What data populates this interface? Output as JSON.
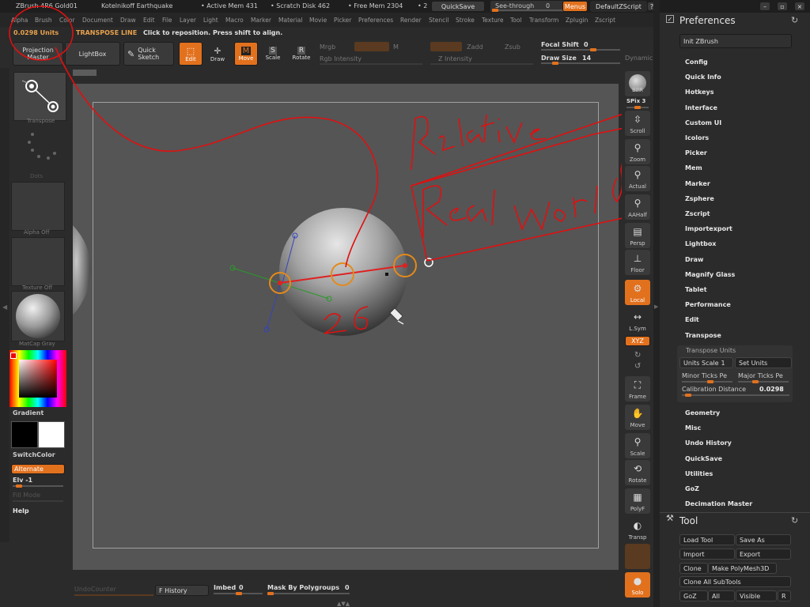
{
  "titlebar": {
    "app": "ZBrush 4R6 Gold01",
    "user": "Kotelnikoff Earthquake",
    "active_mem": "• Active Mem 431",
    "scratch": "• Scratch Disk 462",
    "free_mem": "• Free Mem 2304",
    "dot": "• 2",
    "quicksave": "QuickSave",
    "seethrough": "See-through",
    "seethrough_val": "0",
    "menus": "Menus",
    "defaultzscript": "DefaultZScript"
  },
  "menubar": [
    "Alpha",
    "Brush",
    "Color",
    "Document",
    "Draw",
    "Edit",
    "File",
    "Layer",
    "Light",
    "Macro",
    "Marker",
    "Material",
    "Movie",
    "Picker",
    "Preferences",
    "Render",
    "Stencil",
    "Stroke",
    "Texture",
    "Tool",
    "Transform",
    "Zplugin",
    "Zscript"
  ],
  "infobar": {
    "units": "0.0298 Units",
    "transpose": "TRANSPOSE LINE",
    "hint": "Click to reposition. Press shift to align."
  },
  "toolbar": {
    "projection_master": "Projection Master",
    "lightbox": "LightBox",
    "quick_sketch": "Quick Sketch",
    "edit": "Edit",
    "draw": "Draw",
    "move": "Move",
    "scale": "Scale",
    "rotate": "Rotate",
    "mrgb": "Mrgb",
    "rgb_intensity": "Rgb Intensity",
    "m": "M",
    "zadd": "Zadd",
    "zsub": "Zsub",
    "z_intensity": "Z Intensity",
    "focal_shift": "Focal Shift",
    "focal_val": "0",
    "draw_size": "Draw Size",
    "draw_size_val": "14",
    "dynamic": "Dynamic"
  },
  "leftpanel": {
    "transpose": "Transpose",
    "dots": "Dots",
    "alpha_off": "Alpha Off",
    "texture_off": "Texture Off",
    "matcap": "MatCap Gray",
    "gradient": "Gradient",
    "switchcolor": "SwitchColor",
    "alternate": "Alternate",
    "elv": "Elv -1",
    "fill_mode": "Fill Mode",
    "help": "Help"
  },
  "canvas": {
    "annotation_number": "26"
  },
  "rightshelf": {
    "bpr": "BPR",
    "spix": "SPix 3",
    "scroll": "Scroll",
    "zoom": "Zoom",
    "actual": "Actual",
    "aahalf": "AAHalf",
    "persp": "Persp",
    "floor": "Floor",
    "local": "Local",
    "lsym": "L.Sym",
    "xyz": "XYZ",
    "frame": "Frame",
    "move": "Move",
    "scale": "Scale",
    "rotate": "Rotate",
    "polyf": "PolyF",
    "transp": "Transp",
    "solo": "Solo"
  },
  "preferences": {
    "title": "Preferences",
    "init": "Init ZBrush",
    "items": [
      "Config",
      "Quick Info",
      "Hotkeys",
      "Interface",
      "Custom UI",
      "Icolors",
      "Picker",
      "Mem",
      "Marker",
      "Zsphere",
      "Zscript",
      "Importexport",
      "Lightbox",
      "Draw",
      "Magnify Glass",
      "Tablet",
      "Performance",
      "Edit",
      "Transpose"
    ],
    "transpose_units": "Transpose Units",
    "units_scale": "Units Scale",
    "units_scale_val": "1",
    "set_units": "Set Units",
    "minor_ticks": "Minor Ticks Pe",
    "major_ticks": "Major Ticks Pe",
    "calibration": "Calibration Distance",
    "calibration_val": "0.0298",
    "items2": [
      "Geometry",
      "Misc",
      "Undo History",
      "QuickSave",
      "Utilities",
      "GoZ",
      "Decimation Master"
    ]
  },
  "tool": {
    "title": "Tool",
    "load_tool": "Load Tool",
    "save_as": "Save As",
    "import": "Import",
    "export": "Export",
    "clone": "Clone",
    "make_polymesh": "Make PolyMesh3D",
    "clone_all": "Clone All SubTools",
    "goz": "GoZ",
    "all": "All",
    "visible": "Visible",
    "r": "R"
  },
  "bottombar": {
    "undo_counter": "UndoCounter",
    "f_history": "F History",
    "imbed": "Imbed",
    "imbed_val": "0",
    "mask_polygroups": "Mask By Polygroups",
    "mask_val": "0"
  },
  "colors": {
    "accent": "#e2711e",
    "annotation": "#e01010"
  }
}
